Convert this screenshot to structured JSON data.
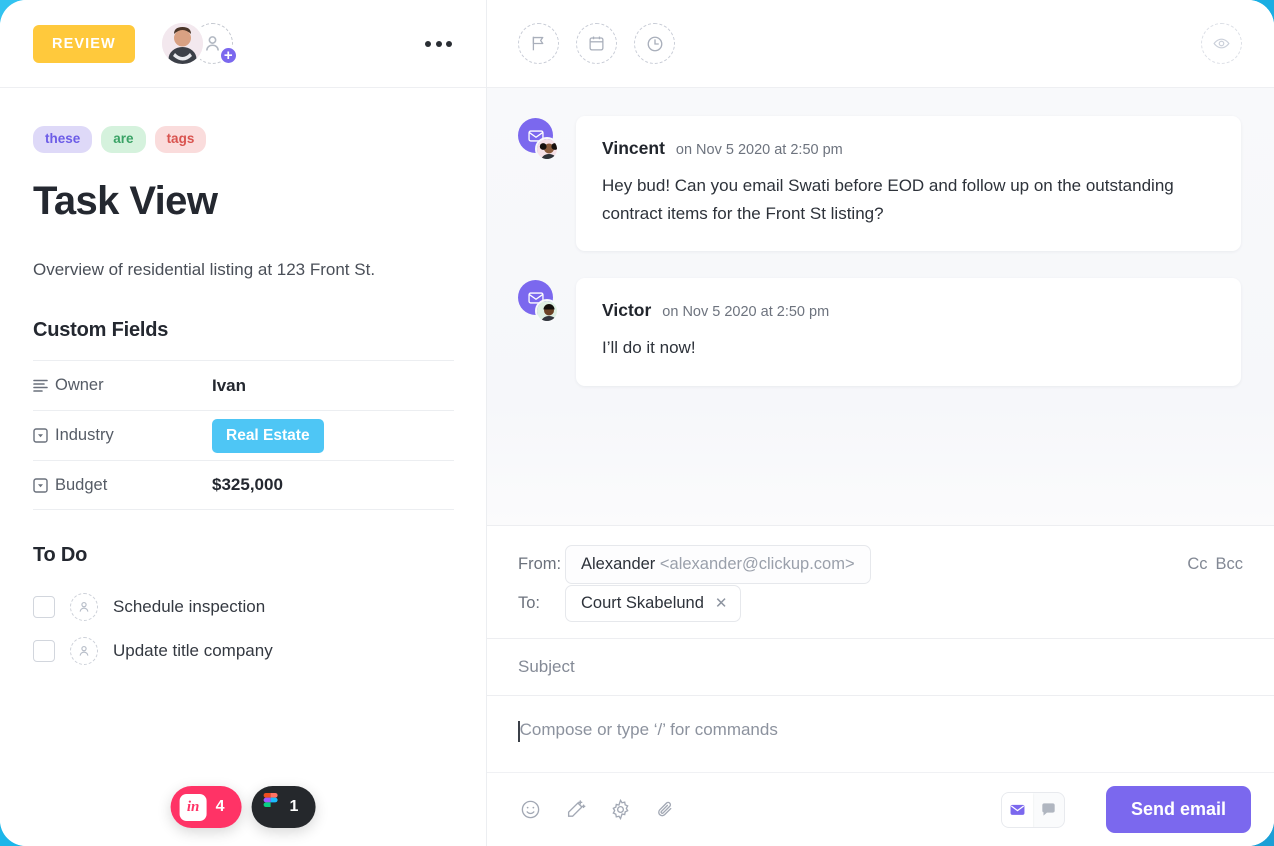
{
  "task": {
    "status_label": "REVIEW",
    "title": "Task View",
    "description": "Overview of residential listing at 123 Front St.",
    "tags": [
      {
        "label": "these",
        "color": "#6c5ce7"
      },
      {
        "label": "are",
        "color": "#3aa366"
      },
      {
        "label": "tags",
        "color": "#d9534f"
      }
    ],
    "custom_fields_title": "Custom Fields",
    "custom_fields": [
      {
        "icon": "text-lines-icon",
        "label": "Owner",
        "value": "Ivan",
        "type": "text"
      },
      {
        "icon": "dropdown-icon",
        "label": "Industry",
        "value": "Real  Estate",
        "type": "chip",
        "chip_color": "#4ec6f5"
      },
      {
        "icon": "dropdown-icon",
        "label": "Budget",
        "value": "$325,000",
        "type": "text"
      }
    ],
    "todo_title": "To Do",
    "todos": [
      {
        "label": "Schedule inspection",
        "checked": false
      },
      {
        "label": "Update title company",
        "checked": false
      }
    ]
  },
  "header_icons": {
    "flag": "flag-icon",
    "calendar": "calendar-icon",
    "clock": "clock-icon",
    "watch": "eye-icon"
  },
  "comments": [
    {
      "author": "Vincent",
      "timestamp": "on Nov 5 2020 at 2:50 pm",
      "text": "Hey bud! Can you email Swati before EOD and follow up on the outstanding contract items for the Front St listing?",
      "badge": "email-icon"
    },
    {
      "author": "Victor",
      "timestamp": "on Nov 5 2020 at 2:50 pm",
      "text": "I’ll do it now!",
      "badge": "email-icon"
    }
  ],
  "composer": {
    "from_label": "From:",
    "from_name": "Alexander",
    "from_email": "<alexander@clickup.com>",
    "to_label": "To:",
    "to_recipient": "Court Skabelund",
    "cc_label": "Cc",
    "bcc_label": "Bcc",
    "subject_placeholder": "Subject",
    "subject_value": "",
    "body_placeholder": "Compose or type ‘/’ for commands",
    "body_value": "",
    "send_label": "Send email",
    "tools": [
      "emoji-icon",
      "magic-wand-icon",
      "gear-icon",
      "paperclip-icon"
    ],
    "mode_email": "email-icon",
    "mode_comment": "comment-bubble-icon"
  },
  "floating_badges": [
    {
      "name": "invision",
      "mark": "in",
      "count": "4",
      "color": "#ff3366"
    },
    {
      "name": "figma",
      "mark": "figma-logo-icon",
      "count": "1",
      "color": "#25282c"
    }
  ],
  "theme": {
    "accent_cyan": "#33c3f0",
    "purple": "#7b68ee",
    "yellow": "#ffc93c"
  }
}
